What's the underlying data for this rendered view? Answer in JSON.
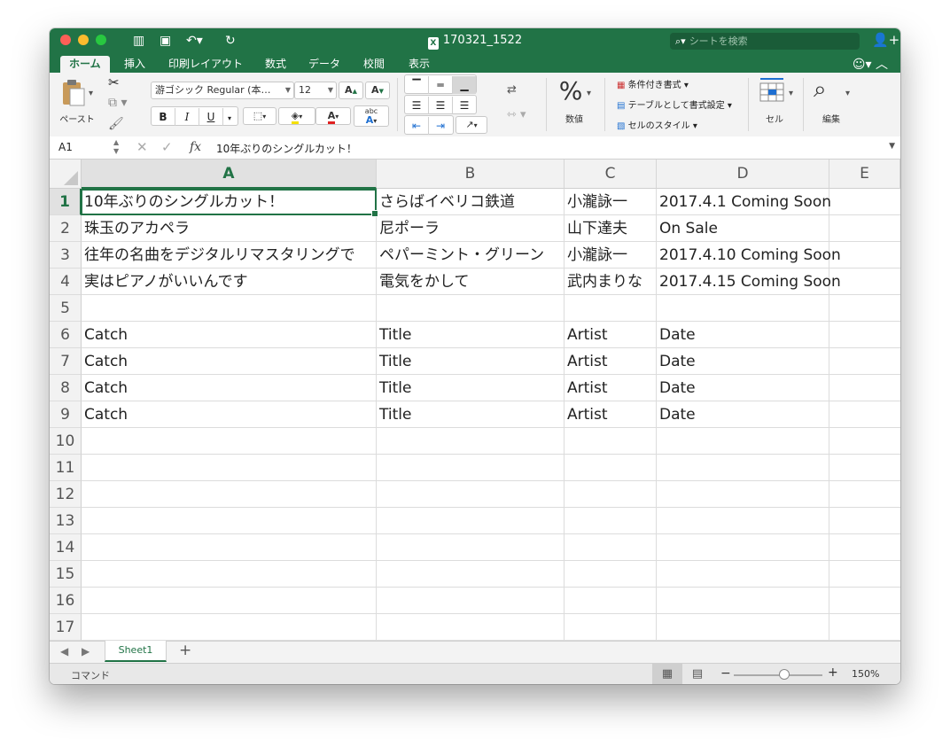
{
  "window": {
    "title": "170321_1522",
    "search_placeholder": "シートを検索"
  },
  "tabs": [
    {
      "label": "ホーム",
      "active": true
    },
    {
      "label": "挿入"
    },
    {
      "label": "印刷レイアウト"
    },
    {
      "label": "数式"
    },
    {
      "label": "データ"
    },
    {
      "label": "校閲"
    },
    {
      "label": "表示"
    }
  ],
  "ribbon": {
    "paste_label": "ペースト",
    "font_name": "游ゴシック Regular (本…",
    "font_size": "12",
    "bold": "B",
    "italic": "I",
    "underline": "U",
    "font_color_letter": "A",
    "phonetic": "abc",
    "phonetic_a": "A",
    "grow_font": "A",
    "shrink_font": "A",
    "percent": "%",
    "number_label": "数値",
    "cond_format": "条件付き書式",
    "format_table": "テーブルとして書式設定",
    "cell_styles": "セルのスタイル",
    "cells_label": "セル",
    "edit_label": "編集",
    "accent_color": "#217346"
  },
  "formula_bar": {
    "name_box": "A1",
    "fx": "fx",
    "content": "10年ぶりのシングルカット！"
  },
  "columns": [
    "A",
    "B",
    "C",
    "D",
    "E"
  ],
  "rows": [
    {
      "num": "1",
      "cells": [
        "10年ぶりのシングルカット！",
        "さらばイベリコ鉄道",
        "小瀧詠一",
        "2017.4.1 Coming Soon"
      ]
    },
    {
      "num": "2",
      "cells": [
        "珠玉のアカペラ",
        "尼ポーラ",
        "山下達夫",
        "On Sale"
      ]
    },
    {
      "num": "3",
      "cells": [
        "往年の名曲をデジタルリマスタリングで",
        "ペパーミント・グリーン",
        "小瀧詠一",
        "2017.4.10 Coming Soon"
      ]
    },
    {
      "num": "4",
      "cells": [
        "実はピアノがいいんです",
        "電気をかして",
        "武内まりな",
        "2017.4.15 Coming Soon"
      ]
    },
    {
      "num": "5",
      "cells": [
        "",
        "",
        "",
        ""
      ]
    },
    {
      "num": "6",
      "cells": [
        "Catch",
        "Title",
        "Artist",
        "Date"
      ]
    },
    {
      "num": "7",
      "cells": [
        "Catch",
        "Title",
        "Artist",
        "Date"
      ]
    },
    {
      "num": "8",
      "cells": [
        "Catch",
        "Title",
        "Artist",
        "Date"
      ]
    },
    {
      "num": "9",
      "cells": [
        "Catch",
        "Title",
        "Artist",
        "Date"
      ]
    },
    {
      "num": "10",
      "cells": [
        "",
        "",
        "",
        ""
      ]
    },
    {
      "num": "11",
      "cells": [
        "",
        "",
        "",
        ""
      ]
    },
    {
      "num": "12",
      "cells": [
        "",
        "",
        "",
        ""
      ]
    },
    {
      "num": "13",
      "cells": [
        "",
        "",
        "",
        ""
      ]
    },
    {
      "num": "14",
      "cells": [
        "",
        "",
        "",
        ""
      ]
    },
    {
      "num": "15",
      "cells": [
        "",
        "",
        "",
        ""
      ]
    },
    {
      "num": "16",
      "cells": [
        "",
        "",
        "",
        ""
      ]
    },
    {
      "num": "17",
      "cells": [
        "",
        "",
        "",
        ""
      ]
    }
  ],
  "sheet_tabs": [
    "Sheet1"
  ],
  "status": {
    "mode": "コマンド",
    "zoom": "150%"
  }
}
